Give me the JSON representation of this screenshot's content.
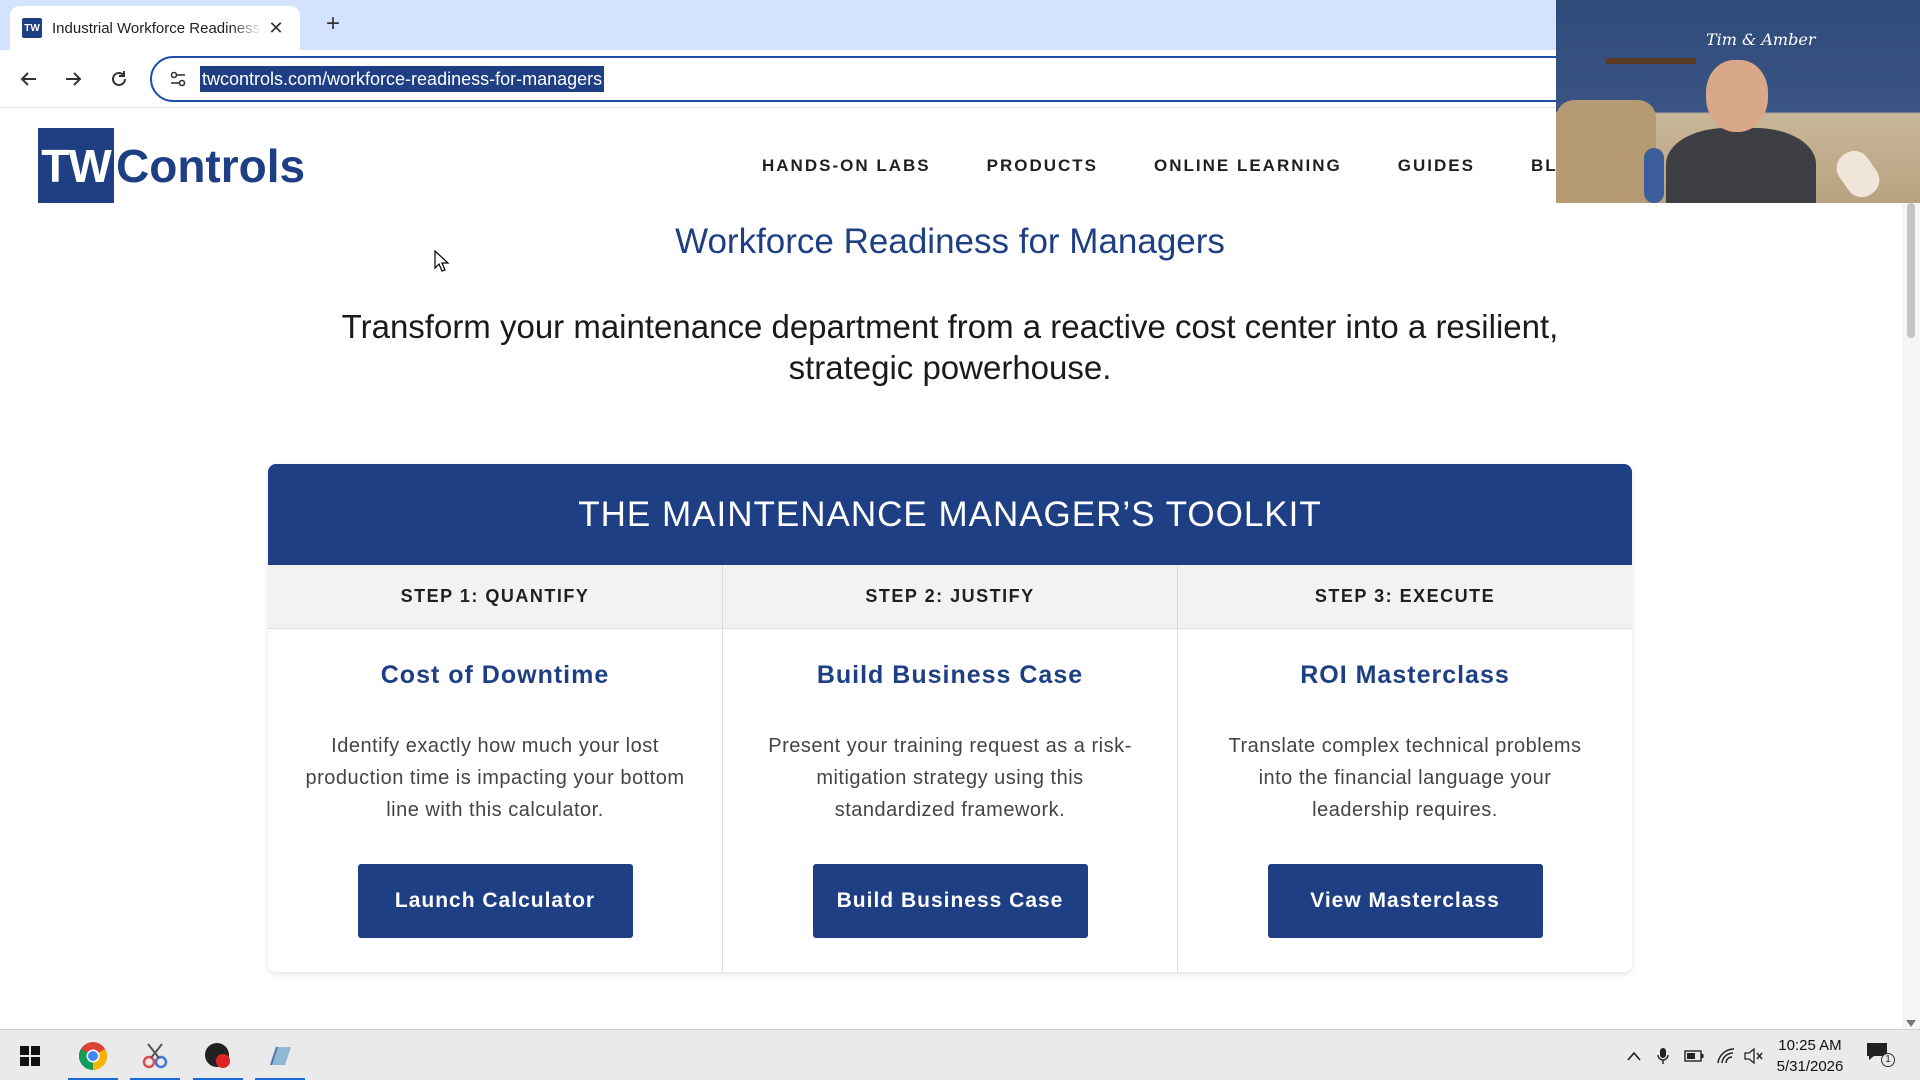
{
  "browser": {
    "tab_title": "Industrial Workforce Readiness",
    "favicon_text": "TW",
    "url": "twcontrols.com/workforce-readiness-for-managers"
  },
  "site": {
    "logo_tw": "TW",
    "logo_controls": "Controls",
    "nav": [
      "HANDS-ON LABS",
      "PRODUCTS",
      "ONLINE LEARNING",
      "GUIDES",
      "BL"
    ]
  },
  "hero": {
    "title": "Workforce Readiness for Managers",
    "subtitle": "Transform your maintenance department from a reactive cost center into a resilient, strategic powerhouse."
  },
  "toolkit": {
    "header": "THE MAINTENANCE MANAGER’S TOOLKIT",
    "columns": [
      {
        "step": "STEP 1: QUANTIFY",
        "title": "Cost of Downtime",
        "description": "Identify exactly how much your lost production time is impacting your bottom line with this calculator.",
        "button": "Launch Calculator"
      },
      {
        "step": "STEP 2: JUSTIFY",
        "title": "Build Business Case",
        "description": "Present your training request as a risk-mitigation strategy using this standardized framework.",
        "button": "Build Business Case"
      },
      {
        "step": "STEP 3: EXECUTE",
        "title": "ROI Masterclass",
        "description": "Translate complex technical problems into the financial language your leadership requires.",
        "button": "View Masterclass"
      }
    ]
  },
  "webcam": {
    "sign": "Tim & Amber"
  },
  "taskbar": {
    "time": "10:25 AM",
    "date": "5/31/2026",
    "notification_count": "1"
  },
  "colors": {
    "brand": "#1e3f84",
    "tabbar": "#d3e3fd",
    "taskbar": "#eaeaea"
  }
}
